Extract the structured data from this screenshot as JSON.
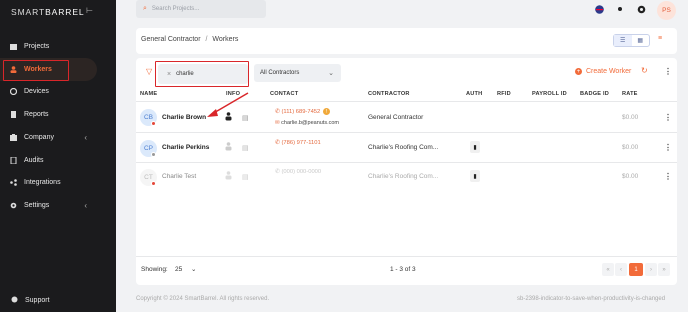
{
  "brand": {
    "part1": "SMART",
    "part2": "BARREL"
  },
  "sidebar": {
    "items": [
      {
        "label": "Projects",
        "icon": "projects-icon"
      },
      {
        "label": "Workers",
        "icon": "workers-icon"
      },
      {
        "label": "Devices",
        "icon": "devices-icon"
      },
      {
        "label": "Reports",
        "icon": "reports-icon"
      },
      {
        "label": "Company",
        "icon": "company-icon"
      },
      {
        "label": "Audits",
        "icon": "audits-icon"
      },
      {
        "label": "Integrations",
        "icon": "integrations-icon"
      },
      {
        "label": "Settings",
        "icon": "settings-icon"
      }
    ],
    "support": "Support"
  },
  "topbar": {
    "search_placeholder": "Search Projects...",
    "avatar": "PS"
  },
  "breadcrumb": {
    "parent": "General Contractor",
    "sep": "/",
    "current": "Workers"
  },
  "filters": {
    "search_value": "charlie",
    "contractor_select": "All Contractors",
    "create_label": "Create Worker"
  },
  "table": {
    "headers": [
      "NAME",
      "INFO",
      "CONTACT",
      "CONTRACTOR",
      "AUTH",
      "RFID",
      "PAYROLL ID",
      "BADGE ID",
      "RATE"
    ],
    "rows": [
      {
        "initials": "CB",
        "name": "Charlie Brown",
        "phone": "(111) 689-7452",
        "email": "charlie.b@peanuts.com",
        "contractor": "General Contractor",
        "rate": "$0.00"
      },
      {
        "initials": "CP",
        "name": "Charlie Perkins",
        "phone": "(786) 977-1101",
        "email": "",
        "contractor": "Charlie's Roofing Com...",
        "rate": "$0.00"
      },
      {
        "initials": "CT",
        "name": "Charlie Test",
        "phone": "(000) 000-0000",
        "email": "",
        "contractor": "Charlie's Roofing Com...",
        "rate": "$0.00"
      }
    ]
  },
  "pagination": {
    "showing_label": "Showing:",
    "per_page": "25",
    "range": "1 - 3 of 3",
    "current_page": "1"
  },
  "footer": {
    "copyright": "Copyright © 2024 SmartBarrel. All rights reserved.",
    "branch": "sb-2398-indicator-to-save-when-productivity-is-changed"
  },
  "colors": {
    "accent": "#f26b3a",
    "annotation": "#d9262a",
    "sidebar_bg": "#1b1b1d"
  }
}
